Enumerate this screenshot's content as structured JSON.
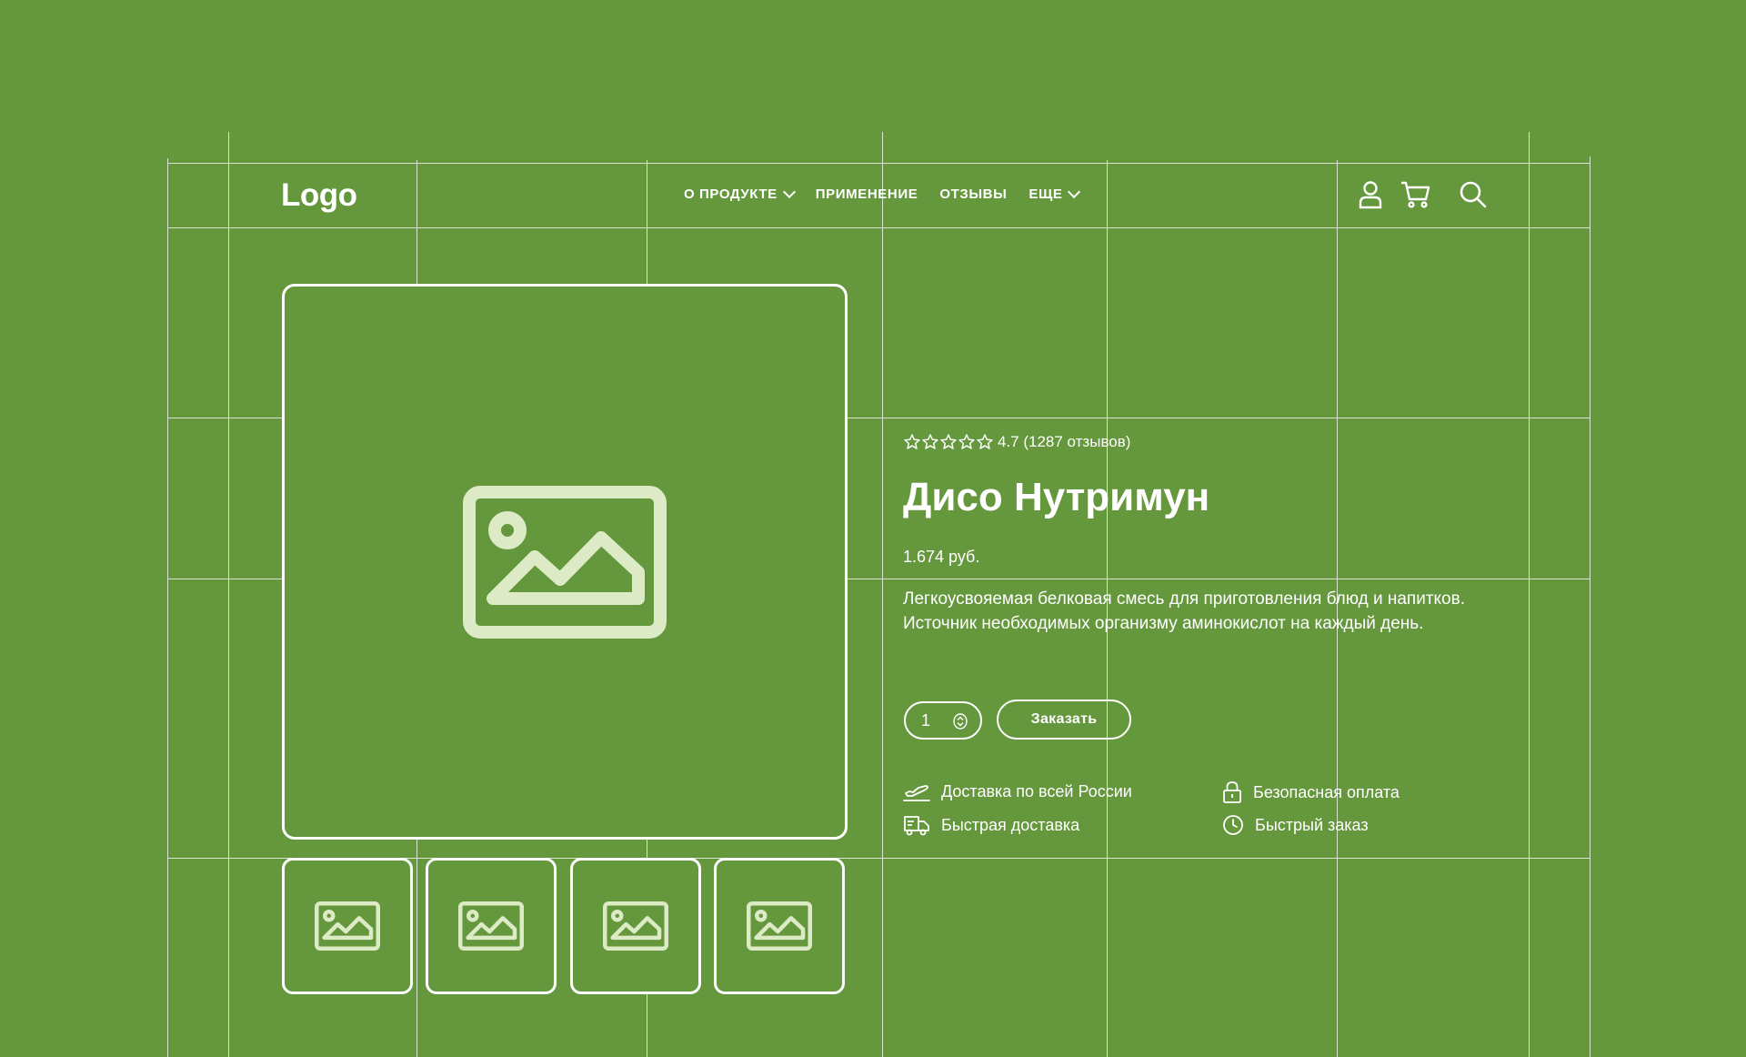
{
  "header": {
    "logo": "Logo",
    "nav": [
      {
        "label": "О ПРОДУКТЕ",
        "dropdown": true
      },
      {
        "label": "ПРИМЕНЕНИЕ",
        "dropdown": false
      },
      {
        "label": "ОТЗЫВЫ",
        "dropdown": false
      },
      {
        "label": "ЕЩЕ",
        "dropdown": true
      }
    ],
    "icons": [
      "user-icon",
      "cart-icon",
      "search-icon"
    ]
  },
  "gallery": {
    "main_icon": "image-placeholder-icon",
    "thumbnail_count": 4
  },
  "product": {
    "rating_stars": 5,
    "rating_text": "4.7 (1287 отзывов)",
    "title": "Дисо Нутримун",
    "price": "1.674 руб.",
    "description": "Легкоусвояемая белковая смесь для приготовления блюд и напитков. Источник необходимых организму аминокислот на каждый день.",
    "quantity": "1",
    "order_button": "Заказать"
  },
  "features": [
    {
      "icon": "plane-icon",
      "label": "Доставка по всей России"
    },
    {
      "icon": "lock-icon",
      "label": "Безопасная оплата"
    },
    {
      "icon": "truck-icon",
      "label": "Быстрая доставка"
    },
    {
      "icon": "clock-icon",
      "label": "Быстрый заказ"
    }
  ],
  "colors": {
    "background": "#65973c",
    "foreground": "#ffffff",
    "placeholder_icon": "#dcebc6"
  }
}
